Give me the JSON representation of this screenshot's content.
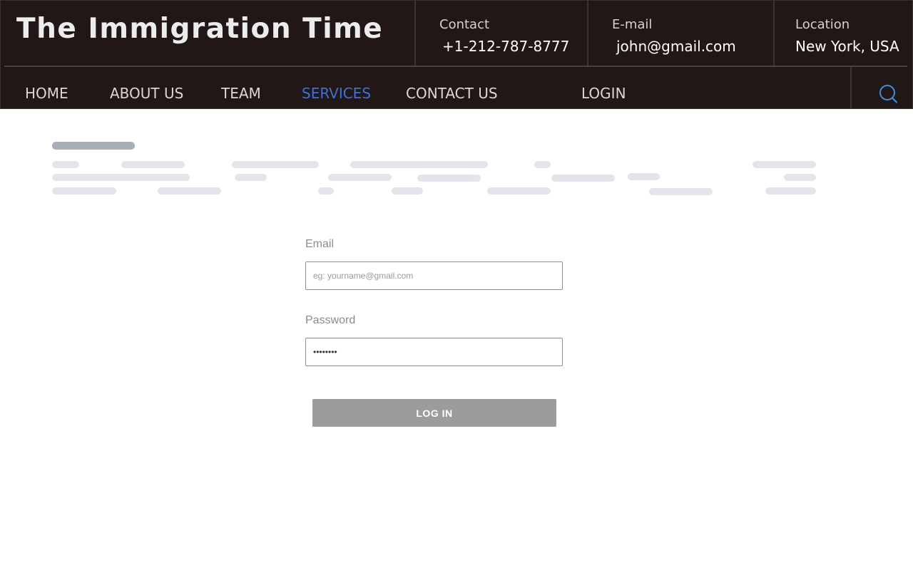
{
  "header": {
    "brand": "The Immigration Time",
    "contact": {
      "label": "Contact",
      "value": "+1-212-787-8777"
    },
    "email": {
      "label": "E-mail",
      "value": "john@gmail.com"
    },
    "location": {
      "label": "Location",
      "value": "New York, USA"
    }
  },
  "nav": {
    "items": [
      {
        "label": "HOME"
      },
      {
        "label": "ABOUT US"
      },
      {
        "label": "TEAM"
      },
      {
        "label": "SERVICES",
        "active": true
      },
      {
        "label": "CONTACT US"
      },
      {
        "label": "LOGIN"
      }
    ],
    "search_icon": "search-icon"
  },
  "form": {
    "email_label": "Email",
    "email_placeholder": "eg: yourname@gmail.com",
    "password_label": "Password",
    "password_value": "••••••••",
    "submit_label": "LOG IN"
  },
  "colors": {
    "header_bg": "#211717",
    "nav_active": "#3f6fd8",
    "button_bg": "#9c9c9c",
    "skeleton": "#e3e5ea",
    "skeleton_title": "#a9afba"
  }
}
